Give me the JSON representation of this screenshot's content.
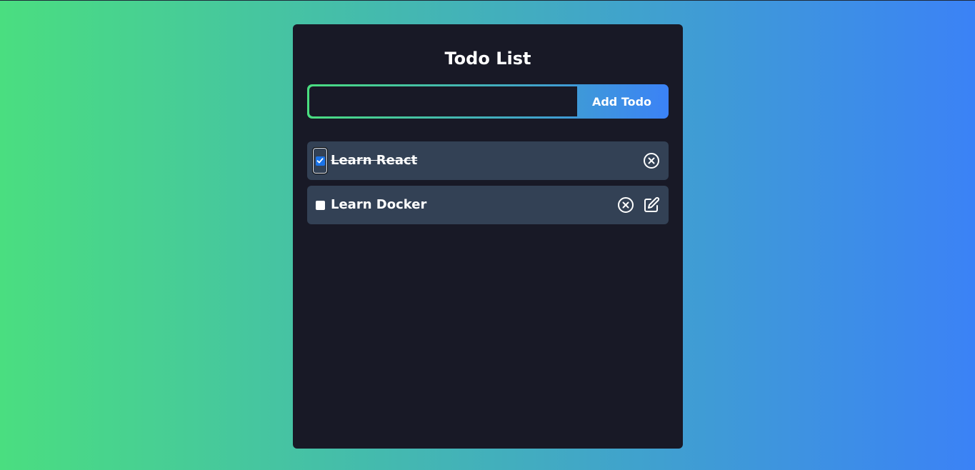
{
  "app": {
    "title": "Todo List"
  },
  "form": {
    "input_value": "",
    "input_placeholder": "",
    "add_button_label": "Add Todo"
  },
  "todos": [
    {
      "text": "Learn React",
      "completed": true,
      "editable": false
    },
    {
      "text": "Learn Docker",
      "completed": false,
      "editable": true
    }
  ],
  "colors": {
    "gradient_start": "#4ade80",
    "gradient_end": "#3b82f6",
    "card_bg": "#181926",
    "item_bg": "#334155",
    "check_accent": "#1a73e8"
  },
  "icons": {
    "delete": "x-circle-icon",
    "edit": "edit-icon",
    "check": "checkmark-icon"
  }
}
